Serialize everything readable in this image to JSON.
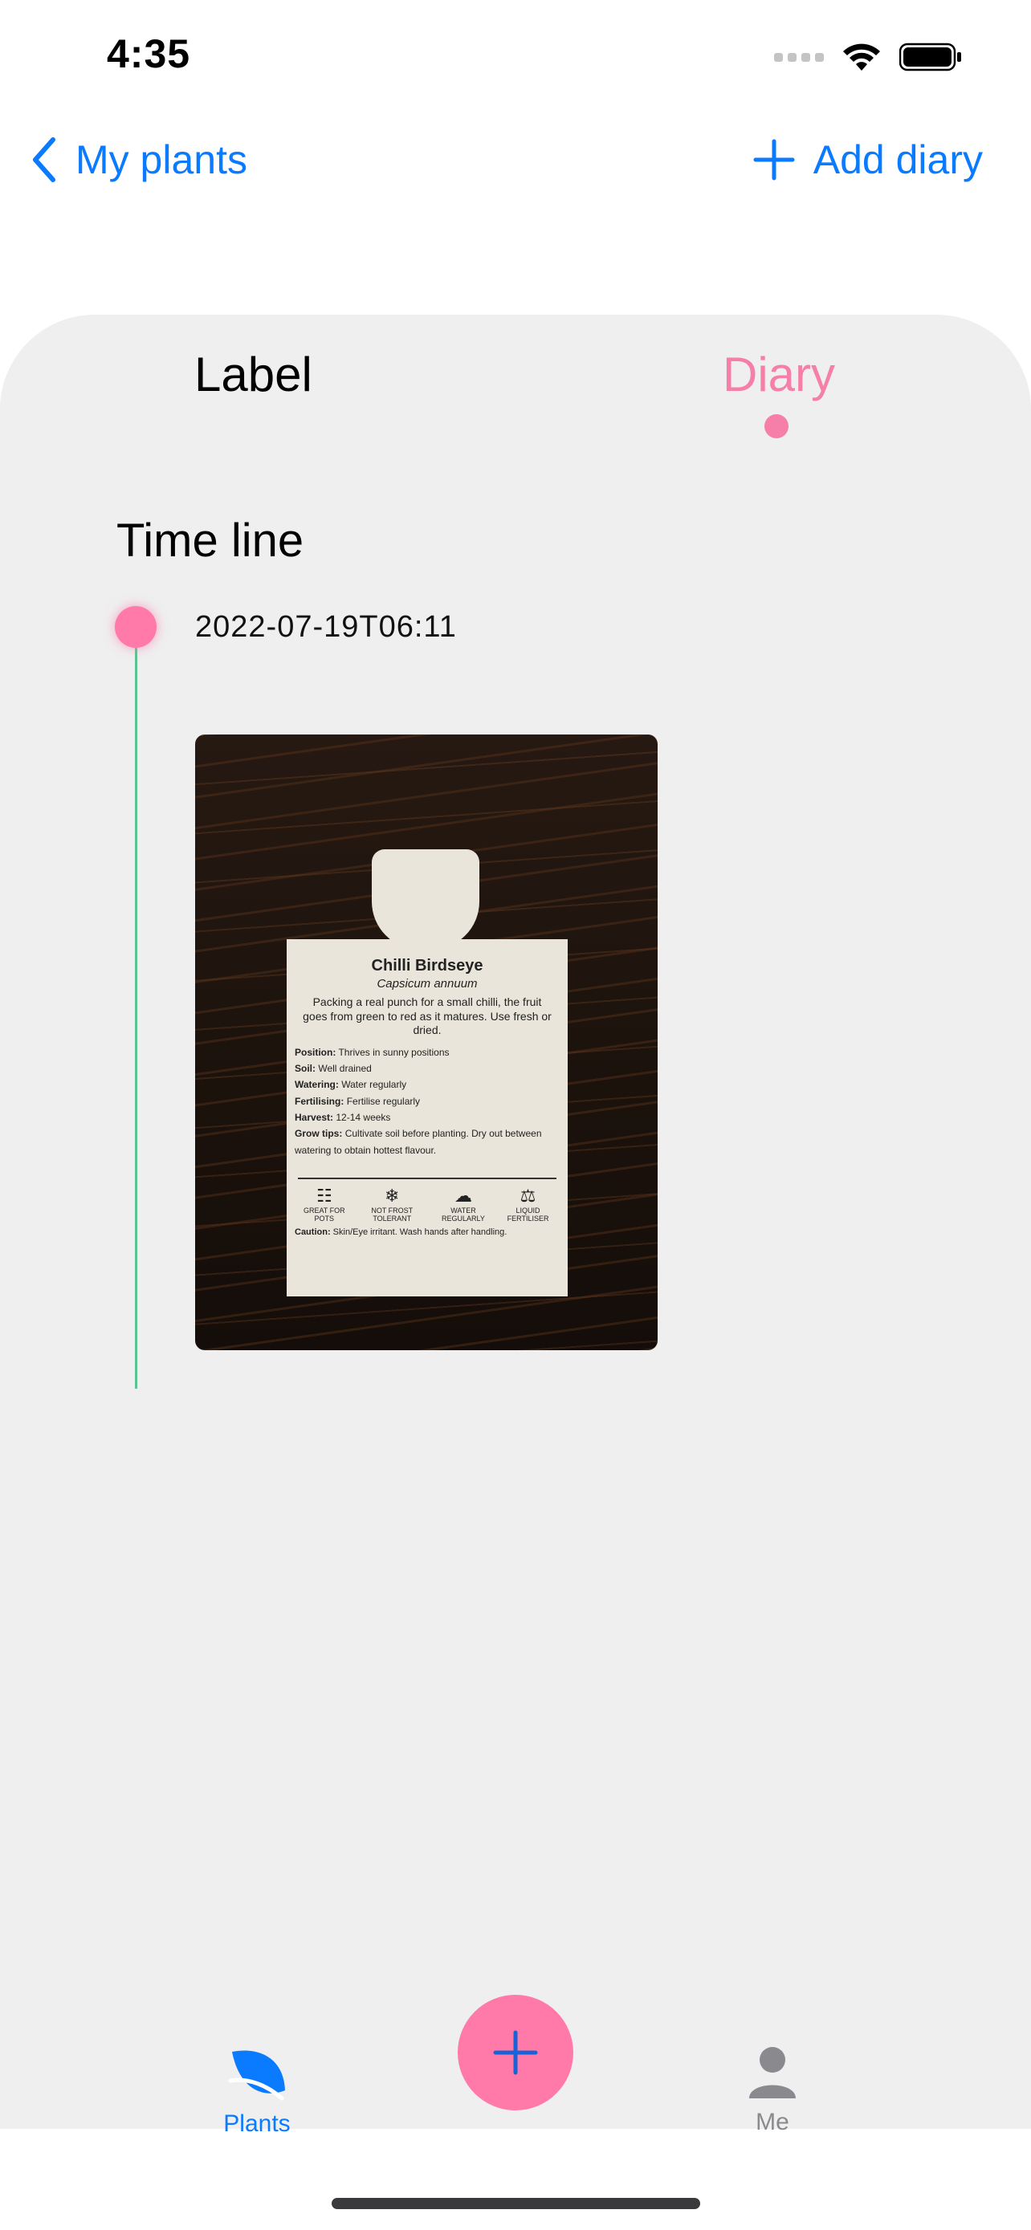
{
  "status_bar": {
    "time": "4:35"
  },
  "nav": {
    "back_label": "My plants",
    "add_label": "Add diary"
  },
  "segments": {
    "label": "Label",
    "diary": "Diary",
    "selected": "Diary"
  },
  "timeline": {
    "title": "Time line",
    "entries": [
      {
        "date": "2022-07-19T06:11"
      }
    ]
  },
  "plant_tag": {
    "name": "Chilli Birdseye",
    "scientific": "Capsicum annuum",
    "description": "Packing a real punch for a small chilli, the fruit goes from green to red as it matures. Use fresh or dried.",
    "lines": [
      {
        "k": "Position:",
        "v": "Thrives in sunny positions"
      },
      {
        "k": "Soil:",
        "v": "Well drained"
      },
      {
        "k": "Watering:",
        "v": "Water regularly"
      },
      {
        "k": "Fertilising:",
        "v": "Fertilise regularly"
      },
      {
        "k": "Harvest:",
        "v": "12-14 weeks"
      },
      {
        "k": "Grow tips:",
        "v": "Cultivate soil before planting. Dry out between watering to obtain hottest flavour."
      }
    ],
    "icons": [
      "GREAT FOR POTS",
      "NOT FROST TOLERANT",
      "WATER REGULARLY",
      "LIQUID FERTILISER"
    ],
    "caution_k": "Caution:",
    "caution_v": "Skin/Eye irritant. Wash hands after handling."
  },
  "tabbar": {
    "plants": "Plants",
    "me": "Me"
  },
  "colors": {
    "accent": "#0a7aff",
    "pink": "#f57fa9",
    "line_green": "#5ac493",
    "sheet_bg": "#efeff0"
  },
  "icons": {
    "back": "chevron-left-icon",
    "add": "plus-icon",
    "plants": "leaf-icon",
    "me": "person-icon",
    "fab": "plus-icon"
  }
}
